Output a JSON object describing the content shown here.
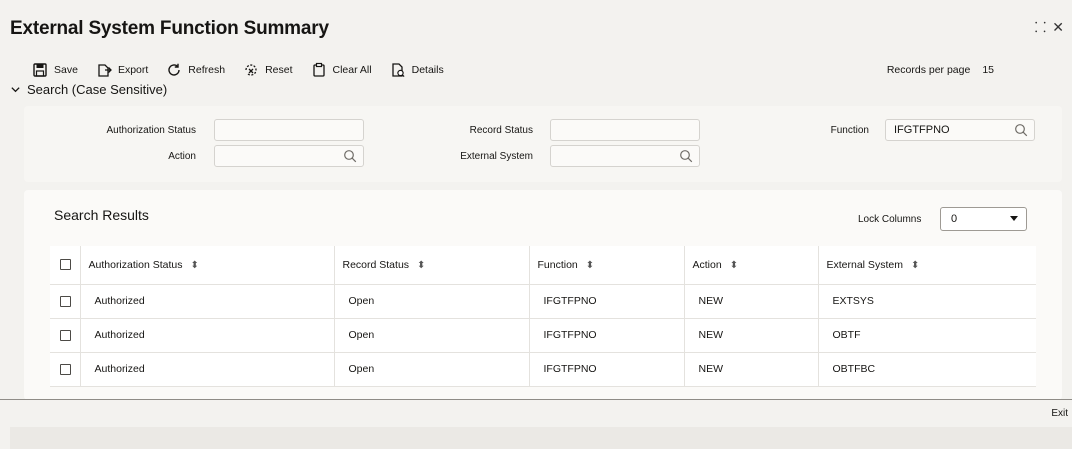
{
  "window": {
    "title": "External System Function Summary"
  },
  "toolbar": {
    "save": "Save",
    "export": "Export",
    "refresh": "Refresh",
    "reset": "Reset",
    "clear_all": "Clear All",
    "details": "Details",
    "records_per_page_label": "Records per page",
    "records_per_page_value": "15"
  },
  "search": {
    "toggle_label": "Search (Case Sensitive)",
    "authorization_status_label": "Authorization Status",
    "authorization_status_value": "",
    "record_status_label": "Record Status",
    "record_status_value": "",
    "function_label": "Function",
    "function_value": "IFGTFPNO",
    "action_label": "Action",
    "action_value": "",
    "external_system_label": "External System",
    "external_system_value": ""
  },
  "results": {
    "title": "Search Results",
    "lock_columns_label": "Lock Columns",
    "lock_columns_value": "0",
    "columns": [
      "Authorization Status",
      "Record Status",
      "Function",
      "Action",
      "External System"
    ],
    "rows": [
      [
        "Authorized",
        "Open",
        "IFGTFPNO",
        "NEW",
        "EXTSYS"
      ],
      [
        "Authorized",
        "Open",
        "IFGTFPNO",
        "NEW",
        "OBTF"
      ],
      [
        "Authorized",
        "Open",
        "IFGTFPNO",
        "NEW",
        "OBTFBC"
      ]
    ]
  },
  "footer": {
    "exit": "Exit"
  },
  "icons": {
    "save": "save-icon",
    "export": "export-icon",
    "refresh": "refresh-icon",
    "reset": "reset-icon",
    "clear_all": "clear-all-icon",
    "details": "details-icon",
    "search": "search-icon",
    "sort": "sort-icon"
  },
  "colors": {
    "background": "#f3f2ef",
    "panel": "#fbfaf8",
    "text": "#161513"
  }
}
